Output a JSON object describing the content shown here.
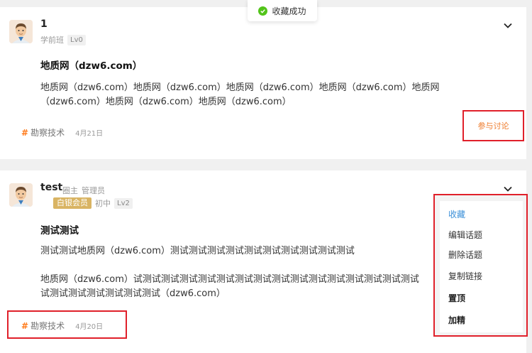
{
  "toast": {
    "text": "收藏成功",
    "icon": "check-circle-icon",
    "color": "#52c41a"
  },
  "posts": [
    {
      "username": "1",
      "group": "学前班",
      "level": "Lv0",
      "title": "地质网（dzw6.com）",
      "body": [
        "地质网（dzw6.com）地质网（dzw6.com）地质网（dzw6.com）地质网（dzw6.com）地质网",
        "（dzw6.com）地质网（dzw6.com）地质网（dzw6.com）"
      ],
      "tag": "勘察技术",
      "date": "4月21日",
      "action_label": "参与讨论"
    },
    {
      "username": "test",
      "roles": [
        "圈主",
        "管理员"
      ],
      "vip": "白银会员",
      "group": "初中",
      "level": "Lv2",
      "title": "测试测试",
      "body_para1": "测试测试地质网（dzw6.com）测试测试测试测试测试测试测试测试测试测试",
      "body_para2": [
        "地质网（dzw6.com）试测试测试测试测试测试测试测试测试测试测试测试测试测试测试测试",
        "试测试测试测试测试测试测试（dzw6.com）"
      ],
      "tag": "勘察技术",
      "date": "4月20日"
    }
  ],
  "menu": {
    "items": [
      {
        "label": "收藏",
        "state": "active"
      },
      {
        "label": "编辑话题",
        "state": "normal"
      },
      {
        "label": "删除话题",
        "state": "normal"
      },
      {
        "label": "复制链接",
        "state": "normal"
      },
      {
        "label": "置顶",
        "state": "strong"
      },
      {
        "label": "加精",
        "state": "strong"
      }
    ]
  },
  "colors": {
    "accent_orange": "#ff7a1a",
    "highlight_red": "#e0202a",
    "menu_active": "#3a8fd8",
    "vip_gold": "#d9b463"
  }
}
